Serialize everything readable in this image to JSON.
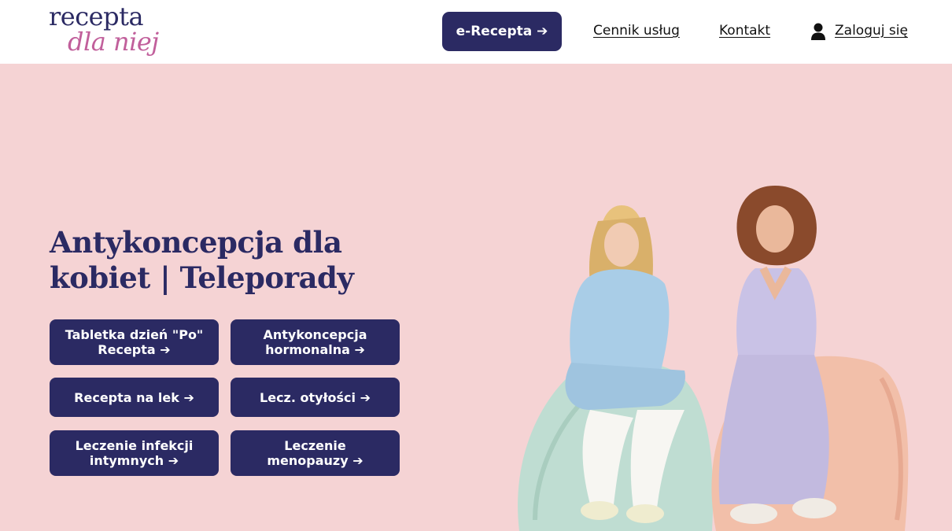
{
  "header": {
    "logo_line1": "recepta",
    "logo_line2": "dla niej",
    "cta_label": "e-Recepta ➔",
    "nav": {
      "pricing": "Cennik usług",
      "contact": "Kontakt",
      "login": "Zaloguj się"
    },
    "user_icon": "user-icon"
  },
  "hero": {
    "title": "Antykoncepcja dla kobiet | Teleporady",
    "services": [
      {
        "label": "Tabletka dzień \"Po\" Recepta ➔"
      },
      {
        "label": "Antykoncepcja hormonalna ➔"
      },
      {
        "label": "Recepta na lek ➔"
      },
      {
        "label": "Lecz. otyłości ➔"
      },
      {
        "label": "Leczenie infekcji intymnych ➔"
      },
      {
        "label": "Leczenie menopauzy ➔"
      }
    ]
  },
  "colors": {
    "brand_navy": "#2b2a63",
    "brand_pink": "#c15f9b",
    "hero_background": "#f5d3d4"
  }
}
